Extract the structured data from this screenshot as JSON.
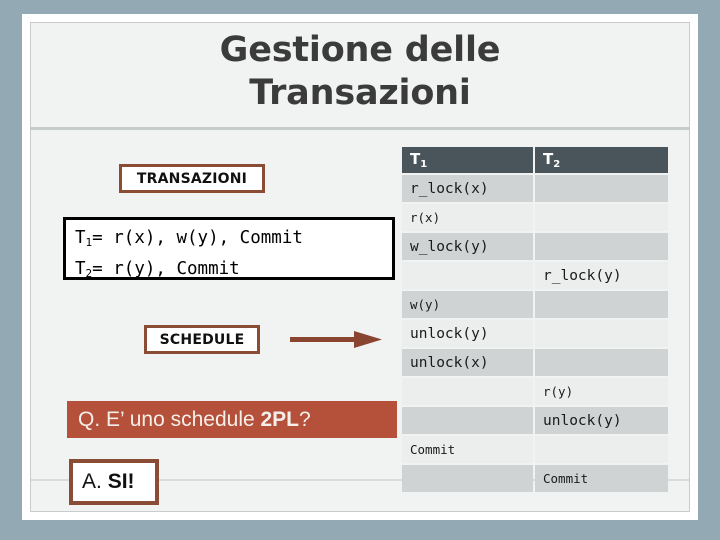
{
  "slide": {
    "title_line1": "Gestione delle",
    "title_line2": "Transazioni"
  },
  "left": {
    "transazioni_label": "TRANSAZIONI",
    "schedule_label": "SCHEDULE",
    "arrow_icon": "right-arrow-icon",
    "formula": {
      "t1_name": "T",
      "t1_sub": "1",
      "t1_body": "= r(x), w(y), Commit",
      "t2_name": "T",
      "t2_sub": "2",
      "t2_body": "= r(y), Commit"
    },
    "question": {
      "prefix": "Q. E’ uno schedule ",
      "emphasis": "2PL",
      "suffix": "?"
    },
    "answer": {
      "prefix": "A. ",
      "emphasis": "SI!"
    }
  },
  "table": {
    "headers": [
      {
        "name": "T",
        "sub": "1"
      },
      {
        "name": "T",
        "sub": "2"
      }
    ],
    "rows": [
      {
        "t1": "r_lock(x)",
        "t2": "",
        "t1_small": false,
        "t2_small": false
      },
      {
        "t1": "r(x)",
        "t2": "",
        "t1_small": true,
        "t2_small": false
      },
      {
        "t1": "w_lock(y)",
        "t2": "",
        "t1_small": false,
        "t2_small": false
      },
      {
        "t1": "",
        "t2": "r_lock(y)",
        "t1_small": false,
        "t2_small": false
      },
      {
        "t1": "w(y)",
        "t2": "",
        "t1_small": true,
        "t2_small": false
      },
      {
        "t1": "unlock(y)",
        "t2": "",
        "t1_small": false,
        "t2_small": false
      },
      {
        "t1": "unlock(x)",
        "t2": "",
        "t1_small": false,
        "t2_small": false
      },
      {
        "t1": "",
        "t2": "r(y)",
        "t1_small": false,
        "t2_small": true
      },
      {
        "t1": "",
        "t2": "unlock(y)",
        "t1_small": false,
        "t2_small": false
      },
      {
        "t1": "Commit",
        "t2": "",
        "t1_small": true,
        "t2_small": false
      },
      {
        "t1": "",
        "t2": "Commit",
        "t1_small": false,
        "t2_small": true
      }
    ]
  },
  "colors": {
    "page_background": "#93a9b4",
    "slide_background": "#f1f2f2",
    "accent_brown": "#8a4c35",
    "banner_red": "#b5503a",
    "table_header": "#49555b",
    "row_odd": "#d0d3d3",
    "row_even": "#eceeee"
  }
}
